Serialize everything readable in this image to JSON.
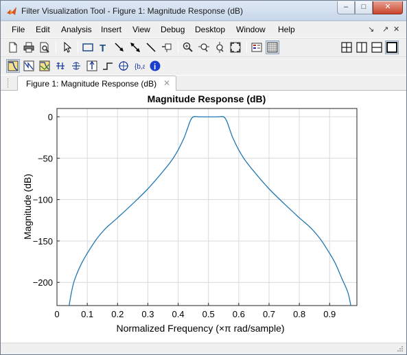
{
  "window": {
    "title": "Filter Visualization Tool - Figure 1: Magnitude Response (dB)",
    "controls": {
      "minimize": "–",
      "maximize": "□",
      "close": "✕"
    }
  },
  "menu": {
    "items": [
      "File",
      "Edit",
      "Analysis",
      "Insert",
      "View",
      "Debug",
      "Desktop",
      "Window",
      "Help"
    ],
    "dock_icons": [
      "↘",
      "↗",
      "✕"
    ]
  },
  "toolbar1": {
    "icons": [
      "new-document-icon",
      "print-icon",
      "print-preview-icon",
      "pointer-icon",
      "rectangle-icon",
      "text-insert-icon",
      "arrow-icon",
      "double-arrow-icon",
      "line-icon",
      "pin-icon",
      "zoom-in-icon",
      "zoom-x-icon",
      "zoom-y-icon",
      "zoom-fit-icon",
      "legend-icon",
      "grid-icon",
      "layout-2x2-icon",
      "layout-columns-icon",
      "layout-rows-icon",
      "layout-single-icon"
    ]
  },
  "toolbar2": {
    "icons": [
      "magnitude-response-icon",
      "phase-response-icon",
      "magnitude-phase-icon",
      "group-delay-icon",
      "phase-delay-icon",
      "impulse-response-icon",
      "step-response-icon",
      "pole-zero-icon",
      "filter-coefficients-icon",
      "info-icon"
    ],
    "info_glyph": "i"
  },
  "tab": {
    "label": "Figure 1: Magnitude Response (dB)",
    "close_glyph": "✕"
  },
  "colors": {
    "line": "#1f77b4",
    "grid": "#d9d9d9",
    "titlebar": "#c7d7ea"
  },
  "chart_data": {
    "type": "line",
    "title": "Magnitude Response (dB)",
    "xlabel": "Normalized Frequency (×π rad/sample)",
    "ylabel": "Magnitude (dB)",
    "xlim": [
      0,
      0.99
    ],
    "ylim": [
      -228,
      10
    ],
    "xticks": [
      0,
      0.1,
      0.2,
      0.3,
      0.4,
      0.5,
      0.6,
      0.7,
      0.8,
      0.9
    ],
    "xtick_labels": [
      "0",
      "0.1",
      "0.2",
      "0.3",
      "0.4",
      "0.5",
      "0.6",
      "0.7",
      "0.8",
      "0.9"
    ],
    "yticks": [
      0,
      -50,
      -100,
      -150,
      -200
    ],
    "ytick_labels": [
      "0",
      "−50",
      "−100",
      "−150",
      "−200"
    ],
    "grid": true,
    "series": [
      {
        "x": [
          0.04,
          0.05,
          0.06,
          0.08,
          0.1,
          0.13,
          0.16,
          0.2,
          0.25,
          0.3,
          0.35,
          0.38,
          0.4,
          0.42,
          0.43,
          0.44,
          0.45,
          0.47,
          0.5,
          0.53,
          0.55,
          0.56,
          0.57,
          0.58,
          0.6,
          0.62,
          0.65,
          0.7,
          0.75,
          0.8,
          0.84,
          0.87,
          0.9,
          0.92,
          0.94,
          0.96,
          0.97
        ],
        "y": [
          -228,
          -208,
          -195,
          -178,
          -165,
          -148,
          -135,
          -122,
          -105,
          -87,
          -66,
          -52,
          -40,
          -25,
          -15,
          -5,
          0,
          0,
          0,
          0,
          0,
          -5,
          -15,
          -25,
          -40,
          -52,
          -66,
          -87,
          -105,
          -122,
          -135,
          -148,
          -165,
          -178,
          -195,
          -212,
          -228
        ]
      }
    ]
  }
}
